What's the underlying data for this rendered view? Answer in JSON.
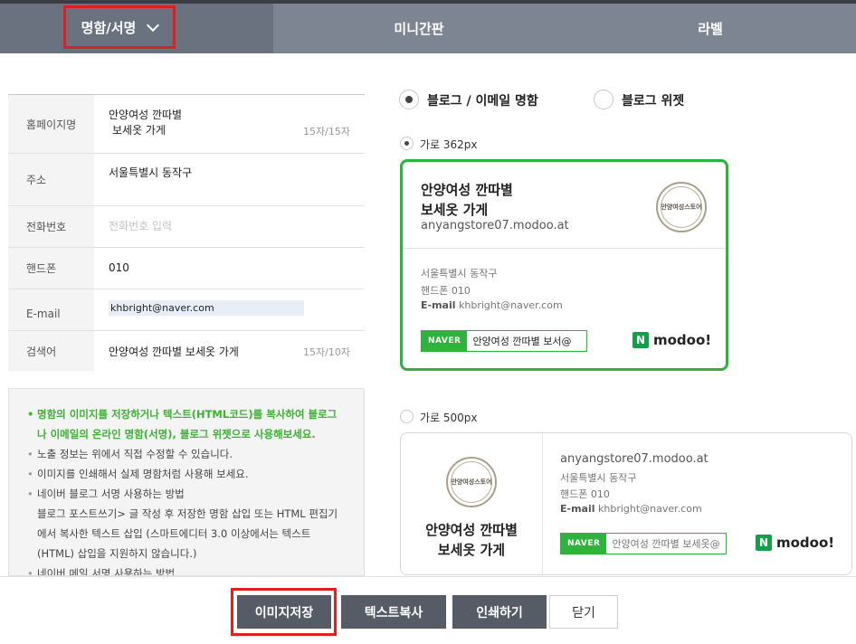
{
  "tabs": [
    {
      "label": "명함/서명",
      "active": true
    },
    {
      "label": "미니간판",
      "active": false
    },
    {
      "label": "라벨",
      "active": false
    }
  ],
  "form": {
    "homepage_label": "홈페이지명",
    "homepage_value_line1": "안양여성 깐따별",
    "homepage_value_line2": "보세옷 가게",
    "homepage_counter": "15자/15자",
    "address_label": "주소",
    "address_value": "서울특별시 동작구",
    "phone_label": "전화번호",
    "phone_placeholder": "전화번호 입력",
    "mobile_label": "핸드폰",
    "mobile_value": "010",
    "email_label": "E-mail",
    "email_value": "khbright@naver.com",
    "keyword_label": "검색어",
    "keyword_value": "안양여성 깐따별 보세옷 가게",
    "keyword_counter": "15자/10자"
  },
  "notes": {
    "note1": "명함의 이미지를 저장하거나 텍스트(HTML코드)를 복사하여 블로그나 이메일의 온라인 명함(서명), 블로그 위젯으로 사용해보세요.",
    "note2": "노출 정보는 위에서 직접 수정할 수 있습니다.",
    "note3": "이미지를 인쇄해서 실제 명함처럼 사용해 보세요.",
    "note4_title": "네이버 블로그 서명 사용하는 방법",
    "note4_body": "블로그 포스트쓰기> 글 작성 후 저장한 명함 삽입 또는 HTML 편집기에서 복사한 텍스트 삽입 (스마트에디터 3.0 이상에서는 텍스트(HTML) 삽입을 지원하지 않습니다.)",
    "note5": "네이버 메일 서명 사용하는 방법"
  },
  "options": {
    "type_blog_email": "블로그 / 이메일 명함",
    "type_blog_widget": "블로그 위젯",
    "size_362": "가로 362px",
    "size_500": "가로 500px"
  },
  "card": {
    "title_line1": "안양여성 깐따별",
    "title_line2": "보세옷 가게",
    "url": "anyangstore07.modoo.at",
    "logo_text": "안양여성스토어",
    "address": "서울특별시 동작구",
    "mobile_label": "핸드폰",
    "mobile_value": "010",
    "email_label": "E-mail",
    "email_value": "khbright@naver.com",
    "naver_badge": "NAVER",
    "search_query_1": "안양여성 깐따별 보서@",
    "search_query_2": "안양여성 깐따별 보세옷@",
    "modoo_mark": "N",
    "modoo_text": "modoo!"
  },
  "buttons": {
    "save_image": "이미지저장",
    "copy_text": "텍스트복사",
    "print": "인쇄하기",
    "close": "닫기"
  },
  "colors": {
    "accent_green": "#2db33e",
    "highlight_red": "#e02020",
    "tab_active": "#6a7280",
    "button_dark": "#565c66"
  }
}
